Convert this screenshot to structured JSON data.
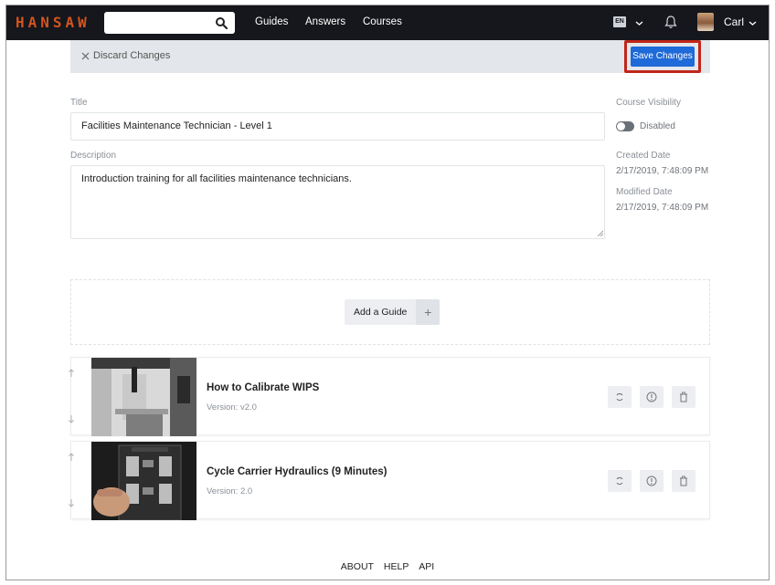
{
  "navbar": {
    "logo": "HANSAW",
    "search_value": "",
    "links": [
      "Guides",
      "Answers",
      "Courses"
    ],
    "language": "EN",
    "user_name": "Carl"
  },
  "actions": {
    "discard_label": "Discard Changes",
    "save_label": "Save Changes"
  },
  "form": {
    "title_label": "Title",
    "title_value": "Facilities Maintenance Technician - Level 1",
    "description_label": "Description",
    "description_value": "Introduction training for all facilities maintenance technicians."
  },
  "meta": {
    "visibility_label": "Course Visibility",
    "visibility_state": "Disabled",
    "visibility_enabled": false,
    "created_label": "Created Date",
    "created_value": "2/17/2019, 7:48:09 PM",
    "modified_label": "Modified Date",
    "modified_value": "2/17/2019, 7:48:09 PM"
  },
  "add_guide": {
    "label": "Add a Guide",
    "plus": "+"
  },
  "guides": [
    {
      "title": "How to Calibrate WIPS",
      "version": "Version: v2.0"
    },
    {
      "title": "Cycle Carrier Hydraulics (9 Minutes)",
      "version": "Version: 2.0"
    }
  ],
  "footer": {
    "links": [
      "ABOUT",
      "HELP",
      "API"
    ]
  },
  "colors": {
    "navbar_bg": "#15171c",
    "logo": "#d4541e",
    "save_button": "#1e6ad8",
    "highlight_outline": "#c0261a"
  },
  "icons": {
    "search": "search-icon",
    "bell": "bell-icon",
    "discard": "close-icon",
    "reorder_up": "arrow-up-icon",
    "reorder_down": "arrow-down-icon",
    "refresh": "refresh-icon",
    "info": "info-icon",
    "delete": "trash-icon"
  }
}
